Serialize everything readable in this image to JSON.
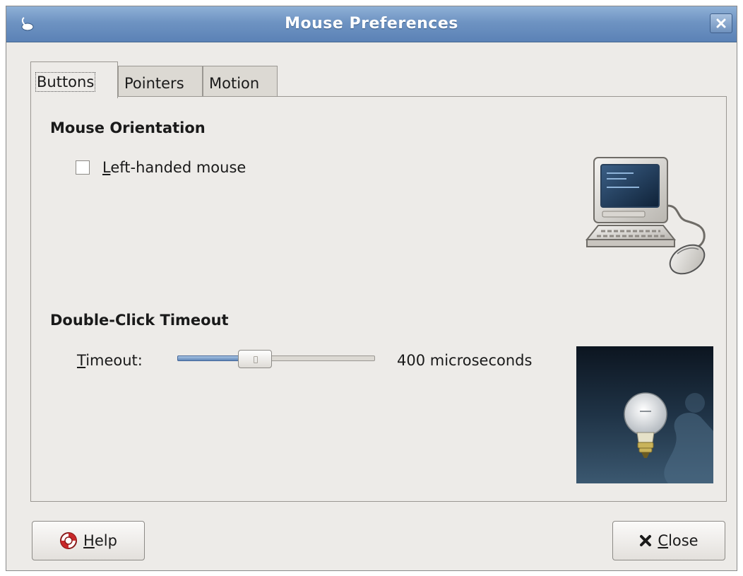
{
  "window": {
    "title": "Mouse Preferences"
  },
  "tabs": [
    {
      "label": "Buttons",
      "active": true
    },
    {
      "label": "Pointers",
      "active": false
    },
    {
      "label": "Motion",
      "active": false
    }
  ],
  "buttons_tab": {
    "orientation": {
      "heading": "Mouse Orientation",
      "checkbox_mnemonic": "L",
      "checkbox_rest": "eft-handed mouse",
      "checked": false
    },
    "double_click": {
      "heading": "Double-Click Timeout",
      "label_mnemonic": "T",
      "label_rest": "imeout:",
      "slider_fraction": 0.37,
      "value_text": "400 microseconds"
    }
  },
  "footer": {
    "help_mnemonic": "H",
    "help_rest": "elp",
    "close_mnemonic": "C",
    "close_rest": "lose"
  },
  "icons": {
    "app": "mouse-app-icon",
    "close": "close-x-icon",
    "help": "help-lifebuoy-icon",
    "close_button": "close-x-icon",
    "illustration1": "computer-mouse-illustration",
    "illustration2": "lightbulb-illustration"
  },
  "colors": {
    "titlebar": "#6e93c2",
    "window_bg": "#edebe8",
    "accent": "#5f86b8"
  }
}
